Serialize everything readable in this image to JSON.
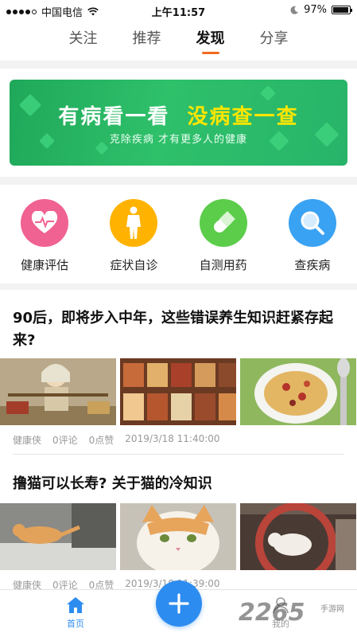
{
  "status_bar": {
    "carrier": "中国电信",
    "time": "上午11:57",
    "battery": "97%",
    "battery_level": 0.97
  },
  "top_tabs": [
    {
      "label": "关注",
      "active": false
    },
    {
      "label": "推荐",
      "active": false
    },
    {
      "label": "发现",
      "active": true
    },
    {
      "label": "分享",
      "active": false
    }
  ],
  "banner": {
    "title_part1": "有病看一看",
    "title_part2": "没病查一查",
    "subtitle": "克除疾病 才有更多人的健康"
  },
  "entries": [
    {
      "label": "健康评估",
      "icon": "heart-pulse-icon",
      "color": "#f06292"
    },
    {
      "label": "症状自诊",
      "icon": "body-figure-icon",
      "color": "#ffb300"
    },
    {
      "label": "自测用药",
      "icon": "pill-icon",
      "color": "#5ccd4b"
    },
    {
      "label": "查疾病",
      "icon": "magnifier-icon",
      "color": "#3aa2f2"
    }
  ],
  "articles": [
    {
      "title": "90后，即将步入中年，这些错误养生知识赶紧存起来?",
      "author": "健康侠",
      "comments": "0评论",
      "likes": "0点赞",
      "time": "2019/3/18 11:40:00"
    },
    {
      "title": "撸猫可以长寿? 关于猫的冷知识",
      "author": "健康侠",
      "comments": "0评论",
      "likes": "0点赞",
      "time": "2019/3/18 11:39:00"
    }
  ],
  "bottom_nav": {
    "home_label": "首页",
    "mine_label": "我的"
  },
  "watermark": {
    "logo": "2265",
    "site": "手游网"
  },
  "colors": {
    "accent": "#2d8cf0",
    "tab_indicator": "#f26a21",
    "banner_green": "#2fc06a",
    "banner_yellow": "#ffe600"
  }
}
